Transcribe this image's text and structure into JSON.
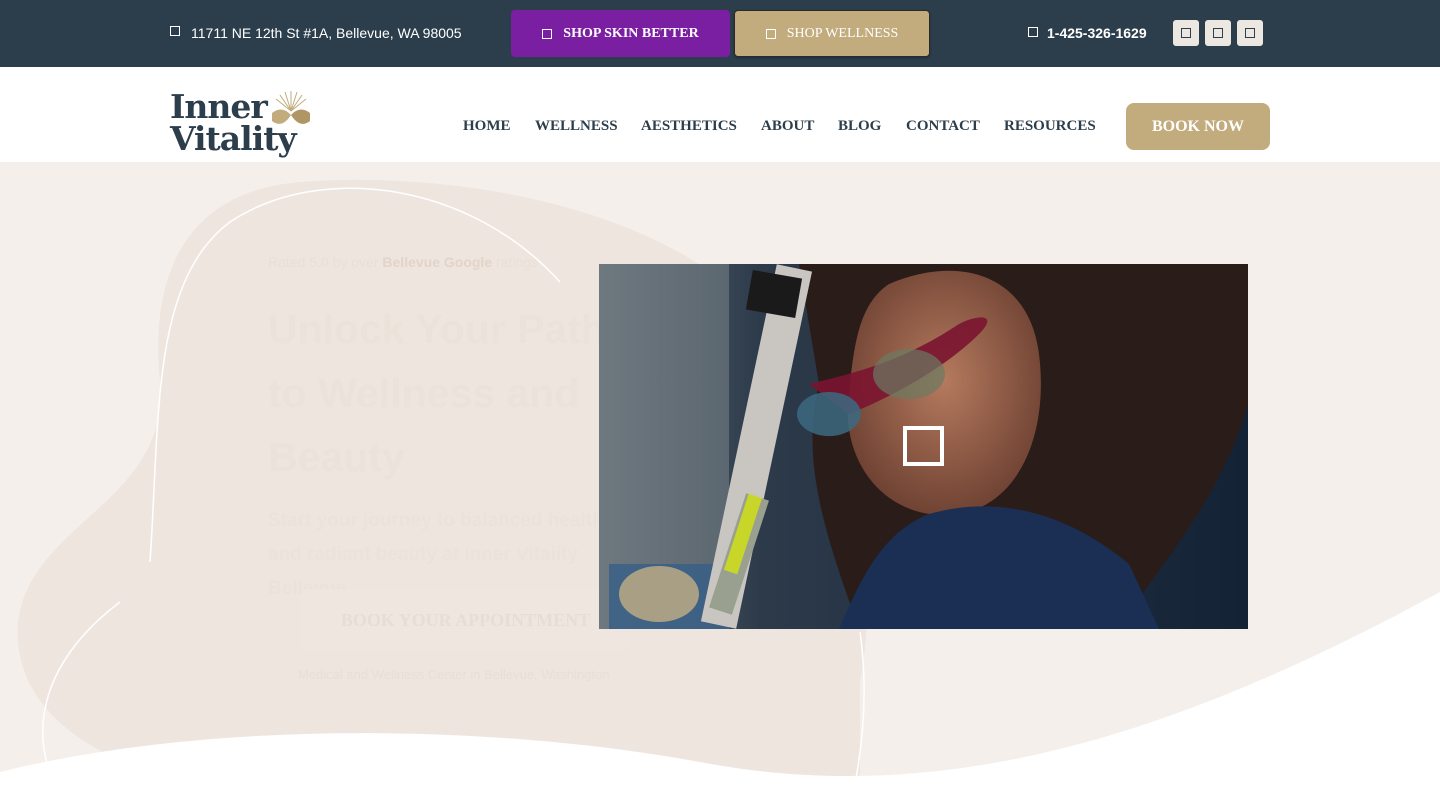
{
  "topbar": {
    "address": "11711 NE 12th St #1A, Bellevue, WA 98005",
    "shop_skin_better": "SHOP SKIN BETTER",
    "shop_wellness": "SHOP WELLNESS",
    "phone": "1-425-326-1629",
    "social_icons": [
      "facebook-icon",
      "instagram-icon",
      "youtube-icon"
    ]
  },
  "header": {
    "logo_line1": "Inner",
    "logo_line2": "Vitality",
    "nav": [
      "HOME",
      "WELLNESS",
      "AESTHETICS",
      "ABOUT",
      "BLOG",
      "CONTACT",
      "RESOURCES"
    ],
    "book_now": "BOOK NOW"
  },
  "hero": {
    "eyebrow_prefix": "Rated 5.0 by over",
    "eyebrow_highlight": "Bellevue Google",
    "eyebrow_suffix": "ratings",
    "headline": "Unlock Your Path to Wellness and Beauty",
    "subtitle": "Start your journey to balanced health and radiant beauty at Inner Vitality Bellevue",
    "cta": "BOOK YOUR APPOINTMENT",
    "caption": "Medical and Wellness Center in Bellevue, Washington",
    "video_play_icon": "play-icon"
  },
  "colors": {
    "topbar_bg": "#2c3e4c",
    "shop_skin_bg": "#7b1fa2",
    "gold": "#c2ab7c",
    "navy_text": "#2c3e4c",
    "hero_bg": "#f5efeb"
  }
}
